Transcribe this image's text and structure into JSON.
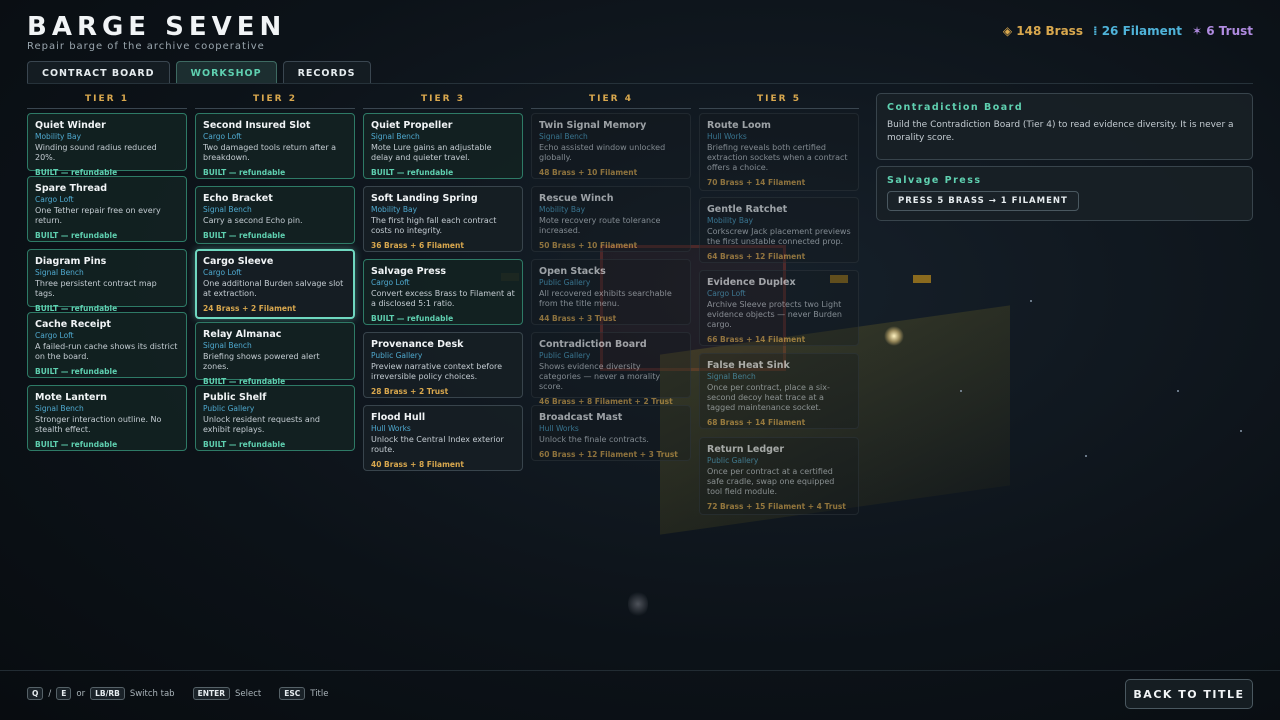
{
  "header": {
    "title": "BARGE SEVEN",
    "subtitle": "Repair barge of the archive cooperative"
  },
  "resources": {
    "brass": "◈ 148 Brass",
    "filament": "⁞ 26 Filament",
    "trust": "✶ 6 Trust"
  },
  "tabs": [
    {
      "label": "CONTRACT BOARD"
    },
    {
      "label": "WORKSHOP"
    },
    {
      "label": "RECORDS"
    }
  ],
  "tiers": [
    {
      "label": "TIER 1",
      "cards": [
        {
          "name": "Quiet Winder",
          "category": "Mobility Bay",
          "desc": "Winding sound radius reduced 20%.",
          "status": "BUILT — refundable",
          "state": "built"
        },
        {
          "name": "Spare Thread",
          "category": "Cargo Loft",
          "desc": "One Tether repair free on every return.",
          "status": "BUILT — refundable",
          "state": "built"
        },
        {
          "name": "Diagram Pins",
          "category": "Signal Bench",
          "desc": "Three persistent contract map tags.",
          "status": "BUILT — refundable",
          "state": "built"
        },
        {
          "name": "Cache Receipt",
          "category": "Cargo Loft",
          "desc": "A failed-run cache shows its district on the board.",
          "status": "BUILT — refundable",
          "state": "built"
        },
        {
          "name": "Mote Lantern",
          "category": "Signal Bench",
          "desc": "Stronger interaction outline. No stealth effect.",
          "status": "BUILT — refundable",
          "state": "built"
        }
      ]
    },
    {
      "label": "TIER 2",
      "cards": [
        {
          "name": "Second Insured Slot",
          "category": "Cargo Loft",
          "desc": "Two damaged tools return after a breakdown.",
          "status": "BUILT — refundable",
          "state": "built"
        },
        {
          "name": "Echo Bracket",
          "category": "Signal Bench",
          "desc": "Carry a second Echo pin.",
          "status": "BUILT — refundable",
          "state": "built"
        },
        {
          "name": "Cargo Sleeve",
          "category": "Cargo Loft",
          "desc": "One additional Burden salvage slot at extraction.",
          "status": "24 Brass + 2 Filament",
          "state": "selected"
        },
        {
          "name": "Relay Almanac",
          "category": "Signal Bench",
          "desc": "Briefing shows powered alert zones.",
          "status": "BUILT — refundable",
          "state": "built"
        },
        {
          "name": "Public Shelf",
          "category": "Public Gallery",
          "desc": "Unlock resident requests and exhibit replays.",
          "status": "BUILT — refundable",
          "state": "built"
        }
      ]
    },
    {
      "label": "TIER 3",
      "cards": [
        {
          "name": "Quiet Propeller",
          "category": "Signal Bench",
          "desc": "Mote Lure gains an adjustable delay and quieter travel.",
          "status": "BUILT — refundable",
          "state": "built"
        },
        {
          "name": "Soft Landing Spring",
          "category": "Mobility Bay",
          "desc": "The first high fall each contract costs no integrity.",
          "status": "36 Brass + 6 Filament",
          "state": "available"
        },
        {
          "name": "Salvage Press",
          "category": "Cargo Loft",
          "desc": "Convert excess Brass to Filament at a disclosed 5:1 ratio.",
          "status": "BUILT — refundable",
          "state": "built"
        },
        {
          "name": "Provenance Desk",
          "category": "Public Gallery",
          "desc": "Preview narrative context before irreversible policy choices.",
          "status": "28 Brass + 2 Trust",
          "state": "available"
        },
        {
          "name": "Flood Hull",
          "category": "Hull Works",
          "desc": "Unlock the Central Index exterior route.",
          "status": "40 Brass + 8 Filament",
          "state": "available"
        }
      ]
    },
    {
      "label": "TIER 4",
      "cards": [
        {
          "name": "Twin Signal Memory",
          "category": "Signal Bench",
          "desc": "Echo assisted window unlocked globally.",
          "status": "48 Brass + 10 Filament",
          "state": "locked"
        },
        {
          "name": "Rescue Winch",
          "category": "Mobility Bay",
          "desc": "Mote recovery route tolerance increased.",
          "status": "50 Brass + 10 Filament",
          "state": "locked"
        },
        {
          "name": "Open Stacks",
          "category": "Public Gallery",
          "desc": "All recovered exhibits searchable from the title menu.",
          "status": "44 Brass + 3 Trust",
          "state": "locked"
        },
        {
          "name": "Contradiction Board",
          "category": "Public Gallery",
          "desc": "Shows evidence diversity categories — never a morality score.",
          "status": "46 Brass + 8 Filament + 2 Trust",
          "state": "locked"
        },
        {
          "name": "Broadcast Mast",
          "category": "Hull Works",
          "desc": "Unlock the finale contracts.",
          "status": "60 Brass + 12 Filament + 3 Trust",
          "state": "locked"
        }
      ]
    },
    {
      "label": "TIER 5",
      "cards": [
        {
          "name": "Route Loom",
          "category": "Hull Works",
          "desc": "Briefing reveals both certified extraction sockets when a contract offers a choice.",
          "status": "70 Brass + 14 Filament",
          "state": "locked"
        },
        {
          "name": "Gentle Ratchet",
          "category": "Mobility Bay",
          "desc": "Corkscrew Jack placement previews the first unstable connected prop.",
          "status": "64 Brass + 12 Filament",
          "state": "locked"
        },
        {
          "name": "Evidence Duplex",
          "category": "Cargo Loft",
          "desc": "Archive Sleeve protects two Light evidence objects — never Burden cargo.",
          "status": "66 Brass + 14 Filament",
          "state": "locked"
        },
        {
          "name": "False Heat Sink",
          "category": "Signal Bench",
          "desc": "Once per contract, place a six-second decoy heat trace at a tagged maintenance socket.",
          "status": "68 Brass + 14 Filament",
          "state": "locked"
        },
        {
          "name": "Return Ledger",
          "category": "Public Gallery",
          "desc": "Once per contract at a certified safe cradle, swap one equipped tool field module.",
          "status": "72 Brass + 15 Filament + 4 Trust",
          "state": "locked"
        }
      ]
    }
  ],
  "detail": {
    "title": "Contradiction Board",
    "text": "Build the Contradiction Board (Tier 4) to read evidence diversity. It is never a morality score."
  },
  "salvage": {
    "title": "Salvage Press",
    "button": "PRESS 5 BRASS → 1 FILAMENT"
  },
  "footer": {
    "key_q": "Q",
    "slash": "/",
    "key_e": "E",
    "or": "or",
    "key_lbrb": "LB/RB",
    "switch_tab": "Switch tab",
    "key_enter": "ENTER",
    "select": "Select",
    "key_esc": "ESC",
    "title": "Title",
    "back": "BACK TO TITLE"
  }
}
